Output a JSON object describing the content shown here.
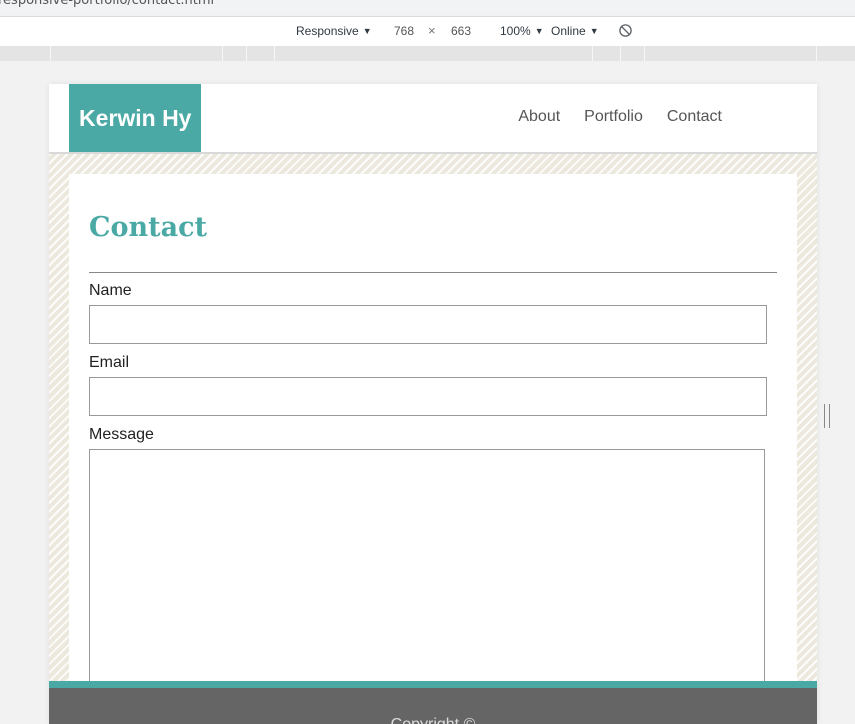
{
  "browser": {
    "url_fragment": "responsive-portfolio/contact.html"
  },
  "device_toolbar": {
    "device_mode": "Responsive",
    "width": "768",
    "times": "×",
    "height": "663",
    "zoom": "100%",
    "throttling": "Online",
    "rotate_icon": "rotate-icon"
  },
  "site": {
    "logo": "Kerwin Hy",
    "nav": [
      "About",
      "Portfolio",
      "Contact"
    ],
    "page_title": "Contact",
    "form": {
      "name_label": "Name",
      "email_label": "Email",
      "message_label": "Message",
      "name_value": "",
      "email_value": "",
      "message_value": ""
    },
    "footer_text": "Copyright ©"
  },
  "colors": {
    "accent": "#4aa9a4",
    "footer": "#656565",
    "pattern": "#ece8dd"
  }
}
